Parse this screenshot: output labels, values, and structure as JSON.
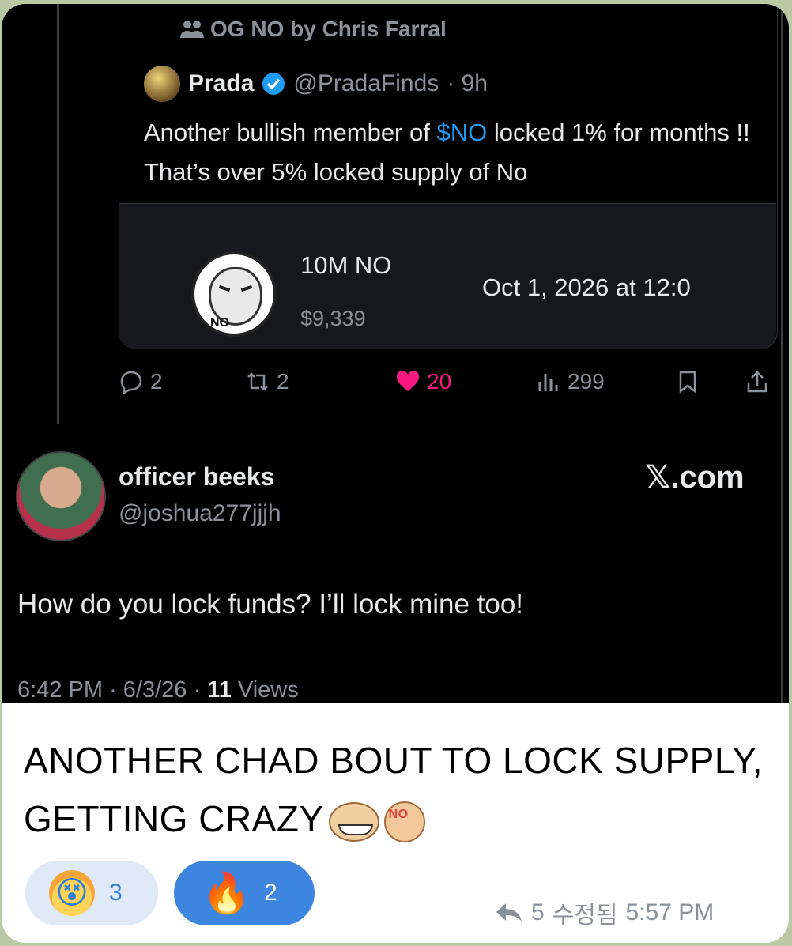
{
  "quoted": {
    "social_context": "OG NO by Chris Farral",
    "author_name": "Prada",
    "author_handle": "@PradaFinds",
    "time": "· 9h",
    "text_before": "Another bullish member of ",
    "cashtag": "$NO",
    "text_after": " locked 1% for months !! That’s over 5% locked supply of No",
    "card": {
      "coin_label": "NO",
      "amount": "10M NO",
      "usd_value": "$9,339",
      "unlock": "Oct 1, 2026 at 12:0"
    },
    "stats": {
      "replies": "2",
      "reposts": "2",
      "likes": "20",
      "views": "299"
    }
  },
  "tweet": {
    "author_name": "officer beeks",
    "author_handle": "@joshua277jjjh",
    "brand": "𝕏.com",
    "text": "How do you lock funds?  I’ll lock mine too!",
    "time": "6:42 PM · 6/3/26 · ",
    "views_count": "11",
    "views_label": " Views"
  },
  "message": {
    "caption": "ANOTHER CHAD BOUT TO LOCK SUPPLY, GETTING CRAZY",
    "emoji_no_tag": "NO",
    "reactions": [
      {
        "icon": "exploding-head-icon",
        "count": "3"
      },
      {
        "icon": "fire-icon",
        "count": "2"
      }
    ],
    "forward_count": "5",
    "edited_label": "수정됨",
    "time": "5:57 PM"
  },
  "colors": {
    "link_blue": "#1d9bf0",
    "like_pink": "#f91880",
    "reaction_blue": "#3e85e0"
  }
}
